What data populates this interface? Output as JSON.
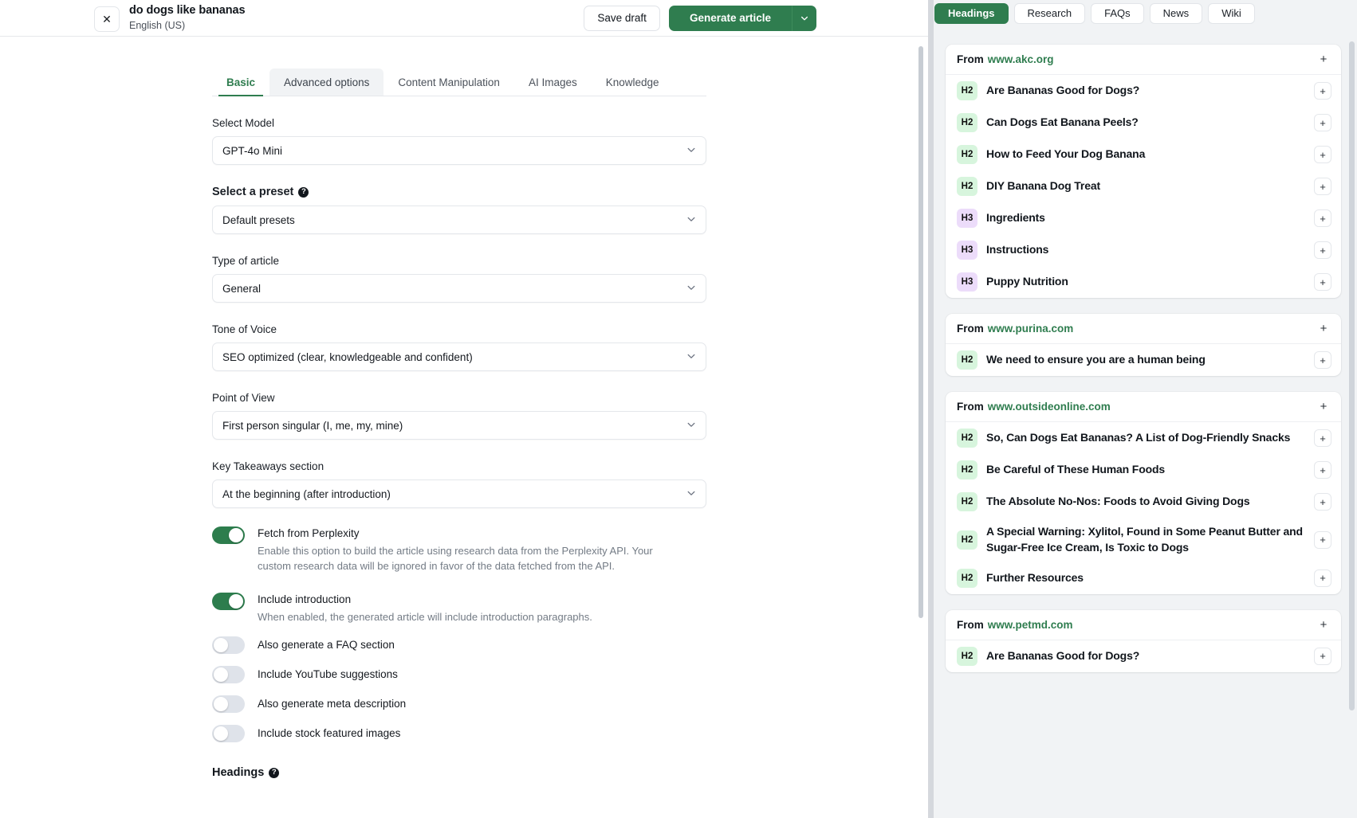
{
  "header": {
    "close_icon": "close-icon",
    "title": "do dogs like bananas",
    "language": "English (US)",
    "save_draft_label": "Save draft",
    "generate_label": "Generate article",
    "generate_caret_icon": "chevron-down-icon"
  },
  "tabs": [
    {
      "label": "Basic",
      "state": "active"
    },
    {
      "label": "Advanced options",
      "state": "hovered"
    },
    {
      "label": "Content Manipulation",
      "state": "default"
    },
    {
      "label": "AI Images",
      "state": "default"
    },
    {
      "label": "Knowledge",
      "state": "default"
    }
  ],
  "form": {
    "fields": [
      {
        "label": "Select Model",
        "value": "GPT-4o Mini",
        "bold": false,
        "help": false
      },
      {
        "label": "Select a preset",
        "value": "Default presets",
        "bold": true,
        "help": true
      },
      {
        "label": "Type of article",
        "value": "General",
        "bold": false,
        "help": false
      },
      {
        "label": "Tone of Voice",
        "value": "SEO optimized (clear, knowledgeable and confident)",
        "bold": false,
        "help": false
      },
      {
        "label": "Point of View",
        "value": "First person singular (I, me, my, mine)",
        "bold": false,
        "help": false
      },
      {
        "label": "Key Takeaways section",
        "value": "At the beginning (after introduction)",
        "bold": false,
        "help": false
      }
    ],
    "toggles": [
      {
        "label": "Fetch from Perplexity",
        "desc": "Enable this option to build the article using research data from the Perplexity API. Your custom research data will be ignored in favor of the data fetched from the API.",
        "on": true
      },
      {
        "label": "Include introduction",
        "desc": "When enabled, the generated article will include introduction paragraphs.",
        "on": true
      },
      {
        "label": "Also generate a FAQ section",
        "desc": "",
        "on": false
      },
      {
        "label": "Include YouTube suggestions",
        "desc": "",
        "on": false
      },
      {
        "label": "Also generate meta description",
        "desc": "",
        "on": false
      },
      {
        "label": "Include stock featured images",
        "desc": "",
        "on": false
      }
    ],
    "headings_footer_label": "Headings"
  },
  "right_panel": {
    "tabs": [
      {
        "label": "Headings",
        "active": true
      },
      {
        "label": "Research",
        "active": false
      },
      {
        "label": "FAQs",
        "active": false
      },
      {
        "label": "News",
        "active": false
      },
      {
        "label": "Wiki",
        "active": false
      }
    ],
    "from_label": "From",
    "add_icon": "plus-icon",
    "cards": [
      {
        "url": "www.akc.org",
        "headings": [
          {
            "level": "H2",
            "text": "Are Bananas Good for Dogs?"
          },
          {
            "level": "H2",
            "text": "Can Dogs Eat Banana Peels?"
          },
          {
            "level": "H2",
            "text": "How to Feed Your Dog Banana"
          },
          {
            "level": "H2",
            "text": "DIY Banana Dog Treat"
          },
          {
            "level": "H3",
            "text": "Ingredients"
          },
          {
            "level": "H3",
            "text": "Instructions"
          },
          {
            "level": "H3",
            "text": "Puppy Nutrition"
          }
        ]
      },
      {
        "url": "www.purina.com",
        "headings": [
          {
            "level": "H2",
            "text": "We need to ensure you are a human being"
          }
        ]
      },
      {
        "url": "www.outsideonline.com",
        "headings": [
          {
            "level": "H2",
            "text": "So, Can Dogs Eat Bananas? A List of Dog-Friendly Snacks"
          },
          {
            "level": "H2",
            "text": "Be Careful of These Human Foods"
          },
          {
            "level": "H2",
            "text": "The Absolute No-Nos: Foods to Avoid Giving Dogs"
          },
          {
            "level": "H2",
            "text": "A Special Warning: Xylitol, Found in Some Peanut Butter and Sugar-Free Ice Cream, Is Toxic to Dogs"
          },
          {
            "level": "H2",
            "text": "Further Resources"
          }
        ]
      },
      {
        "url": "www.petmd.com",
        "headings": [
          {
            "level": "H2",
            "text": "Are Bananas Good for Dogs?"
          }
        ]
      }
    ]
  },
  "colors": {
    "brand_green": "#2f7d4f",
    "h2_badge": "#d7f5dd",
    "h3_badge": "#ecdcfa",
    "panel_bg": "#f1f3f5"
  }
}
